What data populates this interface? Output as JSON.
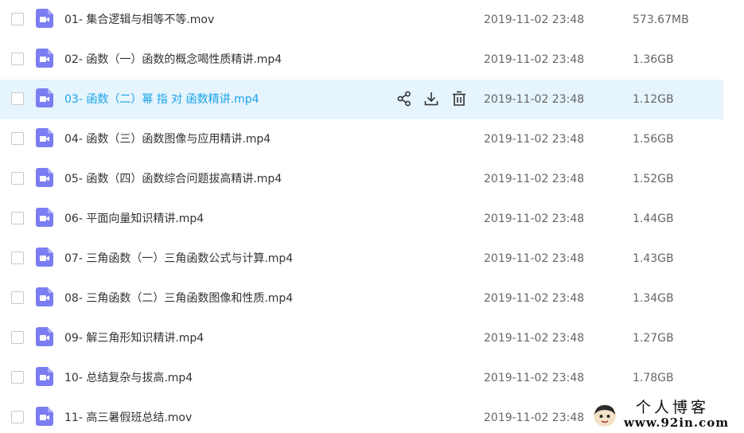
{
  "accent_color": "#1aa3e8",
  "file_icon_color": "#7b7df2",
  "hover_background": "#e6f4fd",
  "files": [
    {
      "name": "01- 集合逻辑与相等不等.mov",
      "date": "2019-11-02 23:48",
      "size": "573.67MB",
      "icon": "video-file-icon"
    },
    {
      "name": "02- 函数（一）函数的概念喝性质精讲.mp4",
      "date": "2019-11-02 23:48",
      "size": "1.36GB",
      "icon": "video-file-icon"
    },
    {
      "name": "03- 函数（二）幂 指 对 函数精讲.mp4",
      "date": "2019-11-02 23:48",
      "size": "1.12GB",
      "icon": "video-file-icon",
      "hovered": true
    },
    {
      "name": "04- 函数（三）函数图像与应用精讲.mp4",
      "date": "2019-11-02 23:48",
      "size": "1.56GB",
      "icon": "video-file-icon"
    },
    {
      "name": "05- 函数（四）函数综合问题拔高精讲.mp4",
      "date": "2019-11-02 23:48",
      "size": "1.52GB",
      "icon": "video-file-icon"
    },
    {
      "name": "06- 平面向量知识精讲.mp4",
      "date": "2019-11-02 23:48",
      "size": "1.44GB",
      "icon": "video-file-icon"
    },
    {
      "name": "07- 三角函数（一）三角函数公式与计算.mp4",
      "date": "2019-11-02 23:48",
      "size": "1.43GB",
      "icon": "video-file-icon"
    },
    {
      "name": "08- 三角函数（二）三角函数图像和性质.mp4",
      "date": "2019-11-02 23:48",
      "size": "1.34GB",
      "icon": "video-file-icon"
    },
    {
      "name": "09- 解三角形知识精讲.mp4",
      "date": "2019-11-02 23:48",
      "size": "1.27GB",
      "icon": "video-file-icon"
    },
    {
      "name": "10- 总结复杂与拔高.mp4",
      "date": "2019-11-02 23:48",
      "size": "1.78GB",
      "icon": "video-file-icon"
    },
    {
      "name": "11- 高三暑假班总结.mov",
      "date": "2019-11-02 23:48",
      "size": "",
      "icon": "video-file-icon"
    }
  ],
  "hover_actions": [
    {
      "icon": "share-icon"
    },
    {
      "icon": "download-icon"
    },
    {
      "icon": "delete-icon"
    }
  ],
  "watermark": {
    "title": "个人博客",
    "url": "www.92in.com"
  }
}
